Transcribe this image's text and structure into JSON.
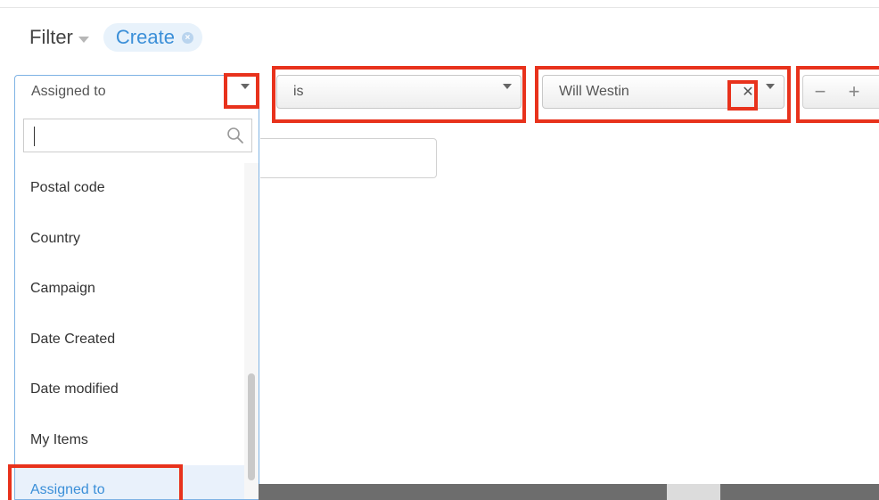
{
  "header": {
    "filter_label": "Filter",
    "pill_label": "Create"
  },
  "filter_row": {
    "field_select": "Assigned to",
    "operator_select": "is",
    "value_select": "Will Westin",
    "minus_label": "−",
    "plus_label": "+"
  },
  "dropdown": {
    "search_value": "",
    "items": [
      {
        "label": "Postal code"
      },
      {
        "label": "Country"
      },
      {
        "label": "Campaign"
      },
      {
        "label": "Date Created"
      },
      {
        "label": "Date modified"
      },
      {
        "label": "My Items"
      },
      {
        "label": "Assigned to",
        "selected": true
      }
    ]
  },
  "colors": {
    "accent": "#3b8fd8",
    "highlight": "#e8321c",
    "pill_bg": "#e8f2fb"
  },
  "icons": [
    "chevron-down-icon",
    "search-icon",
    "clear-x-icon",
    "minus-icon",
    "plus-icon"
  ]
}
